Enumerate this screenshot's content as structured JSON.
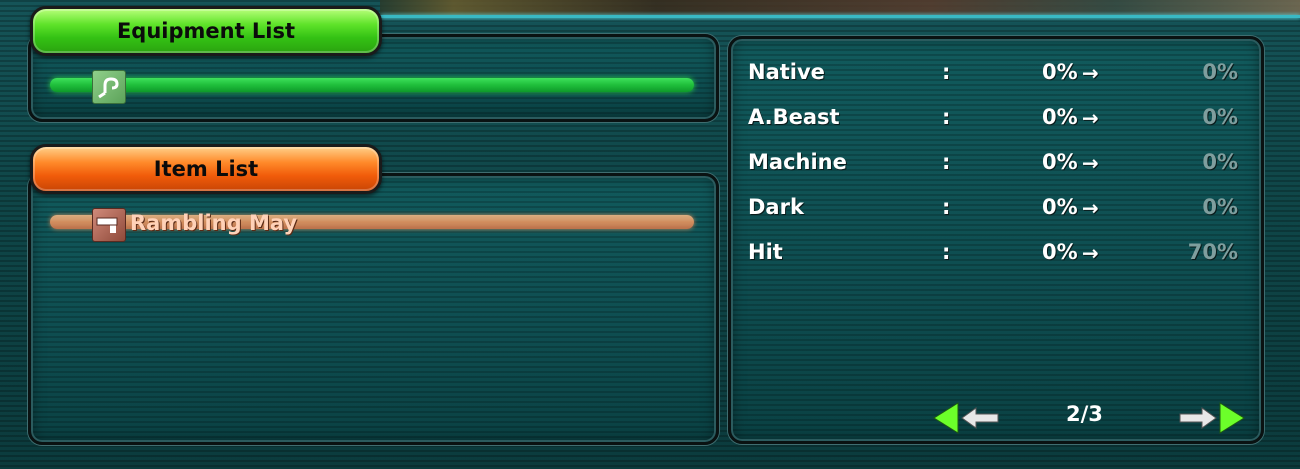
{
  "equipment": {
    "tab_label": "Equipment List"
  },
  "items": {
    "tab_label": "Item List",
    "list": [
      {
        "label": "Rambling May"
      }
    ]
  },
  "stats": [
    {
      "name": "Native",
      "colon": ":",
      "current": "0%",
      "arrow": "→",
      "new": "0%"
    },
    {
      "name": "A.Beast",
      "colon": ":",
      "current": "0%",
      "arrow": "→",
      "new": "0%"
    },
    {
      "name": "Machine",
      "colon": ":",
      "current": "0%",
      "arrow": "→",
      "new": "0%"
    },
    {
      "name": "Dark",
      "colon": ":",
      "current": "0%",
      "arrow": "→",
      "new": "0%"
    },
    {
      "name": "Hit",
      "colon": ":",
      "current": "0%",
      "arrow": "→",
      "new": "70%"
    }
  ],
  "pager": {
    "text": "2/3"
  },
  "colors": {
    "equipment_tab": "#34c214",
    "item_tab": "#f15c0a",
    "accent_nav": "#6cff2a"
  },
  "icons": {
    "equipment_slot": "hook-weapon-icon",
    "item_slot": "gun-item-icon",
    "prev": "arrow-left-icon",
    "next": "arrow-right-icon"
  }
}
